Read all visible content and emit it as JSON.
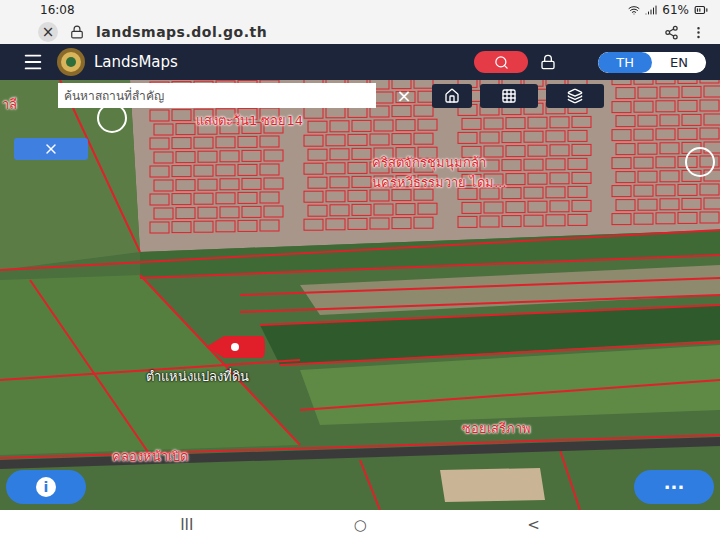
{
  "status_bar": {
    "time": "16:08",
    "battery": "61%"
  },
  "browser": {
    "close": "×",
    "url": "landsmaps.dol.go.th"
  },
  "app": {
    "title": "LandsMaps",
    "languages": [
      {
        "label": "TH",
        "selected": true
      },
      {
        "label": "EN",
        "selected": false
      }
    ]
  },
  "search": {
    "placeholder": "ค้นหาสถานที่สำคัญ",
    "clear": "×"
  },
  "map": {
    "labels": [
      {
        "text": "าลี",
        "kind": "road"
      },
      {
        "text": "แสงตะวัน1 ซอย14",
        "kind": "road"
      },
      {
        "text": "คริสตจักรชุมนุมกล้า",
        "kind": "road"
      },
      {
        "text": "นครหวีธรรมวาย ไดม...",
        "kind": "road"
      },
      {
        "text": "ซอยเสรีภาพ",
        "kind": "road"
      },
      {
        "text": "คลองหน้าเปิด",
        "kind": "road"
      }
    ],
    "pin": {
      "label": "ตำแหน่งแปลงที่ดิน"
    }
  },
  "fabs": {
    "info": "i",
    "more": "···"
  },
  "nav": [
    "III",
    "○",
    "<"
  ]
}
